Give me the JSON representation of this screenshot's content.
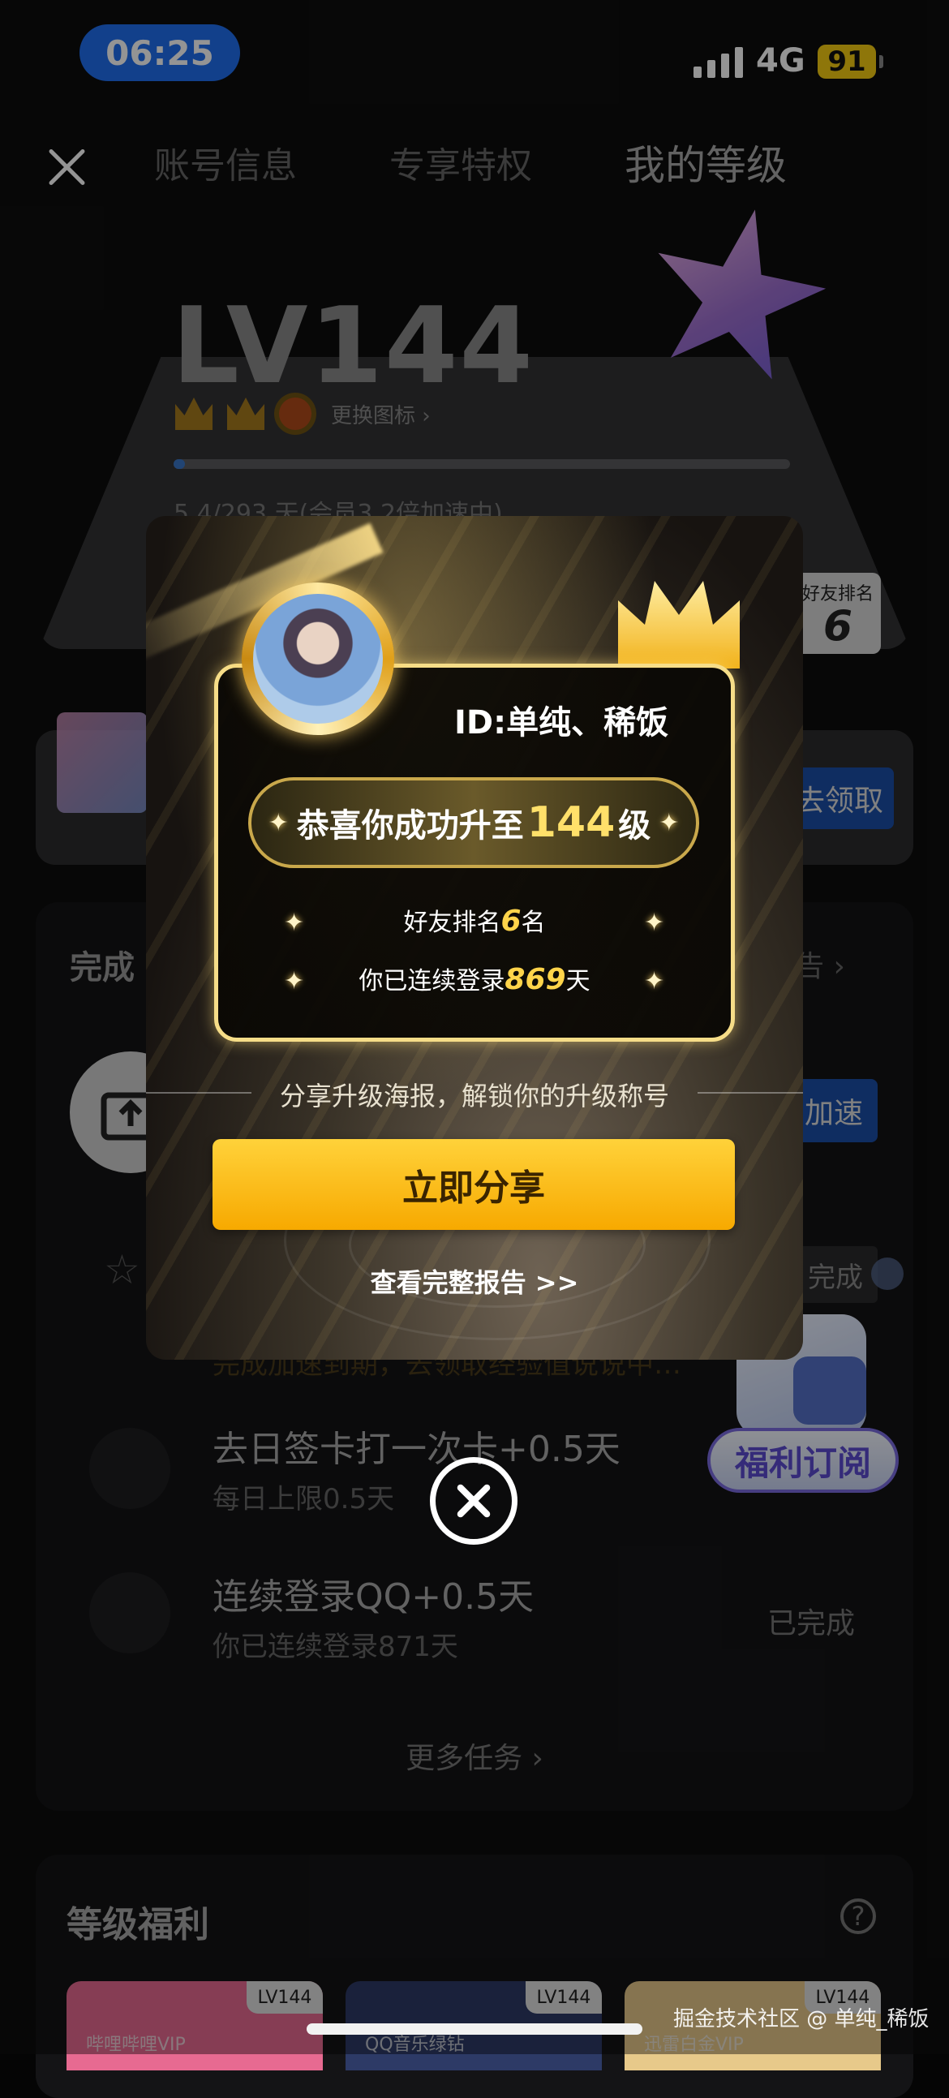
{
  "status_bar": {
    "time": "06:25",
    "network": "4G",
    "battery": "91"
  },
  "nav": {
    "tabs": [
      "账号信息",
      "专享特权",
      "我的等级"
    ],
    "active_tab": 2
  },
  "level_card": {
    "level": "LV144",
    "change_icon_label": "更换图标",
    "change_icon_chevron": "›",
    "progress_text": "5.4/293 天(会员3.2倍加速中)",
    "progress_fraction": 0.018,
    "friend_rank_label": "好友排名",
    "friend_rank_value": "6"
  },
  "benefit_banner": {
    "claim_label": "去领取"
  },
  "tasks": {
    "title": "完成",
    "report_link": "告 ›",
    "accelerate_label": "加速",
    "done_chip": "完成",
    "hidden_line": "完成加速到期，去领取经验值说说中…",
    "items": [
      {
        "title": "去日签卡打一次卡+0.5天",
        "subtitle": "每日上限0.5天"
      },
      {
        "title": "连续登录QQ+0.5天",
        "subtitle": "你已连续登录871天",
        "status": "已完成"
      }
    ],
    "more_tasks": "更多任务 ›",
    "subscription_badge": "福利订阅"
  },
  "level_benefits": {
    "title": "等级福利",
    "help_icon_text": "?",
    "cards": [
      {
        "lv": "LV144",
        "name": "哔哩哔哩VIP",
        "color": "#e76a91"
      },
      {
        "lv": "LV144",
        "name": "QQ音乐绿钻",
        "color": "#2d3a66"
      },
      {
        "lv": "LV144",
        "name": "迅雷白金VIP",
        "color": "#e7c98a"
      }
    ]
  },
  "modal": {
    "user_id": "ID:单纯、稀饭",
    "congrats_prefix": "恭喜你成功升至",
    "congrats_level": "144",
    "congrats_suffix": "级",
    "friend_rank_prefix": "好友排名",
    "friend_rank_value": "6",
    "friend_rank_suffix": "名",
    "login_prefix": "你已连续登录",
    "login_value": "869",
    "login_suffix": "天",
    "share_hint": "分享升级海报，解锁你的升级称号",
    "share_button": "立即分享",
    "report_link": "查看完整报告 >>"
  },
  "watermark": "掘金技术社区 @ 单纯_稀饭",
  "icons": {
    "close": "close-icon",
    "modal_close": "close-circle-icon",
    "upload": "upload-icon",
    "star": "star-icon",
    "calendar": "calendar-check-icon",
    "trend": "trend-icon"
  },
  "colors": {
    "accent_blue": "#1f6ff0",
    "gold": "#ffd44a",
    "button_yellow": "#f7a900"
  }
}
